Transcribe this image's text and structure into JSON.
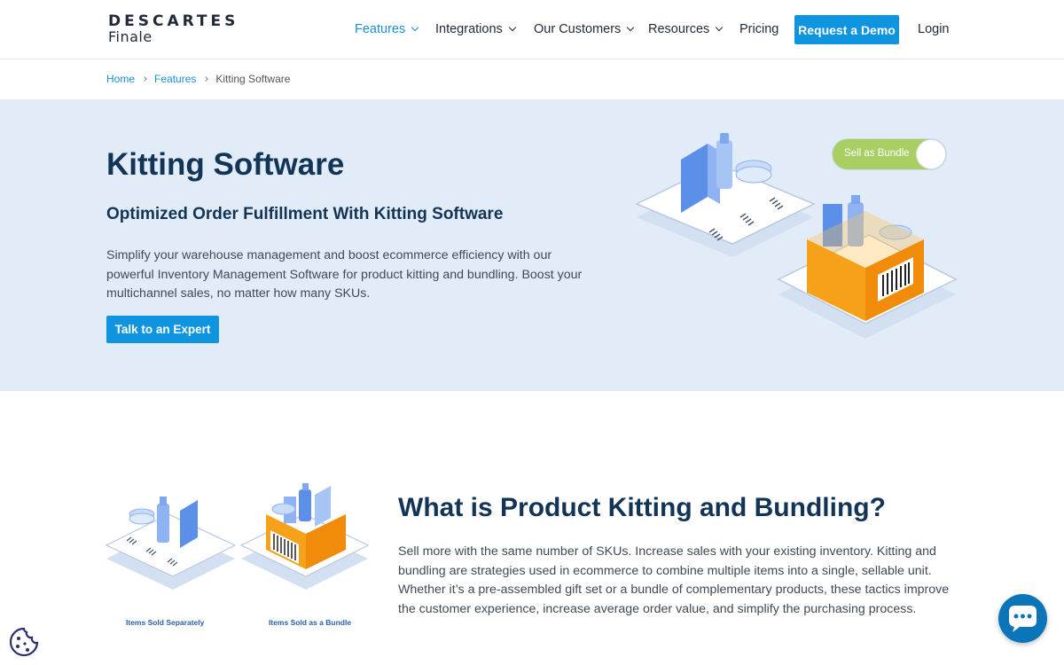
{
  "logo": {
    "top": "DESCARTES",
    "bottom": "Finale"
  },
  "nav": {
    "items": [
      {
        "label": "Features",
        "has_dropdown": true,
        "active": true
      },
      {
        "label": "Integrations",
        "has_dropdown": true
      },
      {
        "label": "Our Customers",
        "has_dropdown": true
      },
      {
        "label": "Resources",
        "has_dropdown": true
      },
      {
        "label": "Pricing",
        "has_dropdown": false
      }
    ],
    "demo_button": "Request a Demo",
    "login": "Login"
  },
  "breadcrumb": {
    "items": [
      "Home",
      "Features",
      "Kitting Software"
    ]
  },
  "hero": {
    "title": "Kitting Software",
    "subtitle": "Optimized Order Fulfillment With Kitting Software",
    "text": "Simplify your warehouse management and boost ecommerce efficiency with our powerful Inventory Management Software for product kitting and bundling. Boost your multichannel sales, no matter how many SKUs.",
    "cta": "Talk to an Expert",
    "toggle_label": "Sell as Bundle"
  },
  "section2": {
    "title": "What is Product Kitting and Bundling?",
    "text": "Sell more with the same number of SKUs. Increase sales with your existing inventory. Kitting and bundling are strategies used in ecommerce to combine multiple items into a single, sellable unit. Whether it’s a pre-assembled gift set or a bundle of complementary products, these tactics improve the customer experience, increase average order value, and simplify the purchasing process.",
    "caption_left": "Items Sold Separately",
    "caption_right": "Items Sold as a Bundle"
  },
  "colors": {
    "accent": "#0f95e0",
    "heading": "#123456",
    "hero_bg": "#e2ecf8",
    "box_orange": "#f7a11a",
    "toggle_green": "#a9cf63",
    "chat_bg": "#0c74b8"
  },
  "icons": {
    "dropdown": "chevron-down-icon",
    "breadcrumb_sep": "chevron-right-icon",
    "cookie": "cookie-icon",
    "chat": "chat-bubble-icon"
  }
}
